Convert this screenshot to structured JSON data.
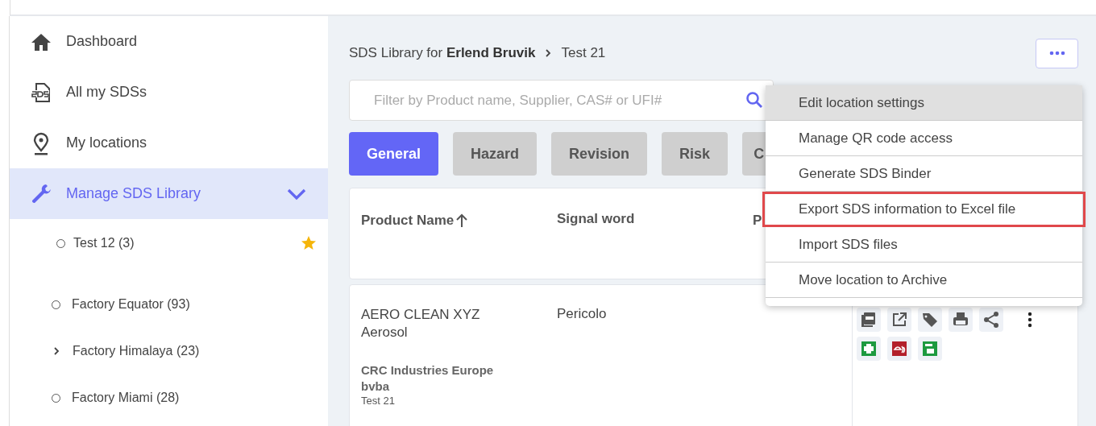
{
  "sidebar": {
    "items": [
      {
        "label": "Dashboard",
        "selected": false
      },
      {
        "label": "All my SDSs",
        "selected": false
      },
      {
        "label": "My locations",
        "selected": false
      },
      {
        "label": "Manage SDS Library",
        "selected": true,
        "expanded": true
      }
    ],
    "favorites": [
      {
        "label": "Test 12",
        "count": "(3)",
        "starred": true
      }
    ],
    "locations": [
      {
        "label": "Factory Equator",
        "count": "(93)",
        "kind": "leaf"
      },
      {
        "label": "Factory Himalaya",
        "count": "(23)",
        "kind": "group",
        "expanded": false
      },
      {
        "label": "Factory Miami",
        "count": "(28)",
        "kind": "leaf"
      }
    ]
  },
  "breadcrumb": {
    "prefix": "SDS Library for",
    "owner": "Erlend Bruvik",
    "current": "Test 21"
  },
  "search": {
    "placeholder": "Filter by Product name, Supplier, CAS# or UFI#"
  },
  "tabs": [
    {
      "label": "General",
      "selected": true
    },
    {
      "label": "Hazard",
      "selected": false
    },
    {
      "label": "Revision",
      "selected": false
    },
    {
      "label": "Risk",
      "selected": false
    },
    {
      "label": "C",
      "selected": false
    }
  ],
  "table": {
    "columns": [
      {
        "label": "Product Name",
        "sorted_ascending": true
      },
      {
        "label": "Signal word",
        "sorted_ascending": false
      },
      {
        "label": "P",
        "sorted_ascending": false
      }
    ],
    "rows": [
      {
        "product": "AERO CLEAN XYZ Aerosol",
        "signal_word": "Pericolo",
        "supplier": "CRC Industries Europe bvba",
        "location": "Test 21"
      }
    ]
  },
  "menu": {
    "items": [
      {
        "label": "Edit location settings",
        "highlighted": true,
        "outlined": false
      },
      {
        "label": "Manage QR code access",
        "highlighted": false,
        "outlined": false
      },
      {
        "label": "Generate SDS Binder",
        "highlighted": false,
        "outlined": false
      },
      {
        "label": "Export SDS information to Excel file",
        "highlighted": false,
        "outlined": true
      },
      {
        "label": "Import SDS files",
        "highlighted": false,
        "outlined": false
      },
      {
        "label": "Move location to Archive",
        "highlighted": false,
        "outlined": false
      }
    ]
  }
}
